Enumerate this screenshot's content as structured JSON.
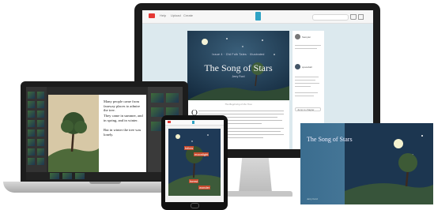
{
  "monitor": {
    "nav": {
      "links": [
        "Help",
        "Upload",
        "Create"
      ]
    },
    "story": {
      "kicker": "Issue 4 · Old Folk Tales · Illustrated",
      "title": "The Song of Stars",
      "author": "Jerry Ford",
      "caption": "The Beginning of the Tree",
      "dropcap": "O"
    },
    "sidebar": {
      "user1": "Sampler",
      "user2": "spaceball",
      "select": "Jump to chapter"
    }
  },
  "laptop": {
    "paragraphs": [
      "Many people came from faraway places to admire the tree.",
      "They came in summer, and in spring, and in winter.",
      "But in winter the tree was lonely."
    ]
  },
  "tablet": {
    "words": [
      "follow",
      "moonlight",
      "forest",
      "wonder"
    ]
  },
  "book": {
    "title": "The Song of Stars",
    "author": "Jerry Ford"
  },
  "colors": {
    "night_sky": "#1d3a55",
    "accent": "#2fa3c5",
    "tag_red": "#c94b2e",
    "book_blue": "#2d5b7a"
  }
}
